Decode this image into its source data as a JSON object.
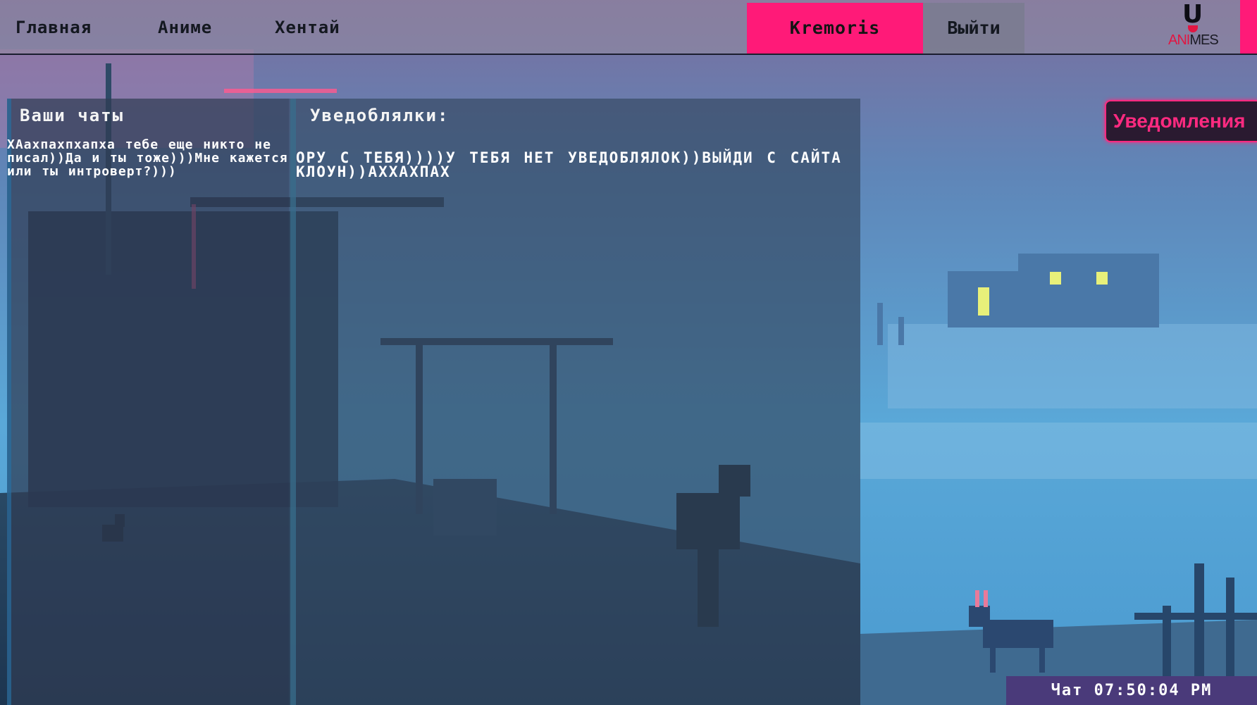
{
  "nav": {
    "home": "Главная",
    "anime": "Аниме",
    "hentai": "Хентай",
    "username": "Kremoris",
    "logout": "Выйти"
  },
  "logo": {
    "letter": "U",
    "text_red": "ANI",
    "text_dark": "MES"
  },
  "chats": {
    "heading": "Ваши чаты",
    "message": "ХАахпахпхапха тебе еще никто не писал))Да и ты тоже)))Мне кажется или ты интроверт?)))"
  },
  "notifications": {
    "heading": "Уведоблялки:",
    "message": "ОРУ С ТЕБЯ))))У ТЕБЯ НЕТ УВЕДОБЛЯЛОК))ВЫЙДИ С САЙТА КЛОУН))АХХАХПАХ",
    "button_label": "Уведомления"
  },
  "clock": {
    "label": "Чат",
    "time": "07:50:04 PM"
  },
  "colors": {
    "accent_pink": "#ff1a78",
    "panel_overlay": "#344860",
    "clock_bg": "#4a3a7a"
  }
}
